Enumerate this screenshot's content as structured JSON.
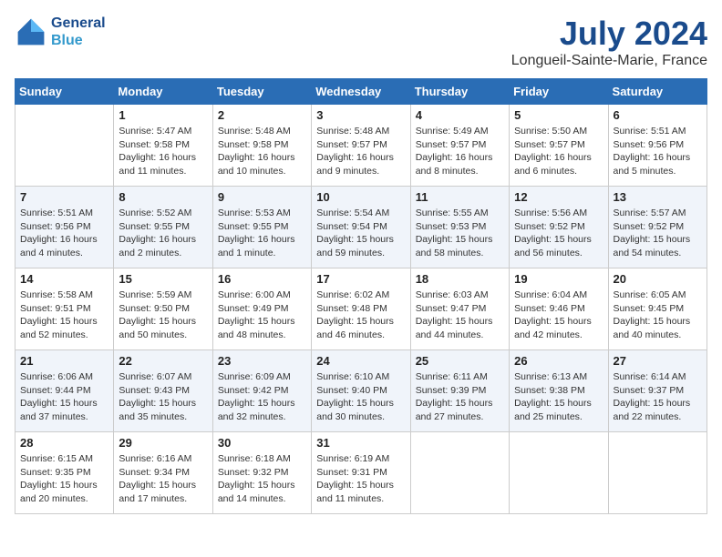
{
  "header": {
    "logo_line1": "General",
    "logo_line2": "Blue",
    "month": "July 2024",
    "location": "Longueil-Sainte-Marie, France"
  },
  "weekdays": [
    "Sunday",
    "Monday",
    "Tuesday",
    "Wednesday",
    "Thursday",
    "Friday",
    "Saturday"
  ],
  "weeks": [
    [
      {
        "day": "",
        "info": ""
      },
      {
        "day": "1",
        "info": "Sunrise: 5:47 AM\nSunset: 9:58 PM\nDaylight: 16 hours\nand 11 minutes."
      },
      {
        "day": "2",
        "info": "Sunrise: 5:48 AM\nSunset: 9:58 PM\nDaylight: 16 hours\nand 10 minutes."
      },
      {
        "day": "3",
        "info": "Sunrise: 5:48 AM\nSunset: 9:57 PM\nDaylight: 16 hours\nand 9 minutes."
      },
      {
        "day": "4",
        "info": "Sunrise: 5:49 AM\nSunset: 9:57 PM\nDaylight: 16 hours\nand 8 minutes."
      },
      {
        "day": "5",
        "info": "Sunrise: 5:50 AM\nSunset: 9:57 PM\nDaylight: 16 hours\nand 6 minutes."
      },
      {
        "day": "6",
        "info": "Sunrise: 5:51 AM\nSunset: 9:56 PM\nDaylight: 16 hours\nand 5 minutes."
      }
    ],
    [
      {
        "day": "7",
        "info": "Sunrise: 5:51 AM\nSunset: 9:56 PM\nDaylight: 16 hours\nand 4 minutes."
      },
      {
        "day": "8",
        "info": "Sunrise: 5:52 AM\nSunset: 9:55 PM\nDaylight: 16 hours\nand 2 minutes."
      },
      {
        "day": "9",
        "info": "Sunrise: 5:53 AM\nSunset: 9:55 PM\nDaylight: 16 hours\nand 1 minute."
      },
      {
        "day": "10",
        "info": "Sunrise: 5:54 AM\nSunset: 9:54 PM\nDaylight: 15 hours\nand 59 minutes."
      },
      {
        "day": "11",
        "info": "Sunrise: 5:55 AM\nSunset: 9:53 PM\nDaylight: 15 hours\nand 58 minutes."
      },
      {
        "day": "12",
        "info": "Sunrise: 5:56 AM\nSunset: 9:52 PM\nDaylight: 15 hours\nand 56 minutes."
      },
      {
        "day": "13",
        "info": "Sunrise: 5:57 AM\nSunset: 9:52 PM\nDaylight: 15 hours\nand 54 minutes."
      }
    ],
    [
      {
        "day": "14",
        "info": "Sunrise: 5:58 AM\nSunset: 9:51 PM\nDaylight: 15 hours\nand 52 minutes."
      },
      {
        "day": "15",
        "info": "Sunrise: 5:59 AM\nSunset: 9:50 PM\nDaylight: 15 hours\nand 50 minutes."
      },
      {
        "day": "16",
        "info": "Sunrise: 6:00 AM\nSunset: 9:49 PM\nDaylight: 15 hours\nand 48 minutes."
      },
      {
        "day": "17",
        "info": "Sunrise: 6:02 AM\nSunset: 9:48 PM\nDaylight: 15 hours\nand 46 minutes."
      },
      {
        "day": "18",
        "info": "Sunrise: 6:03 AM\nSunset: 9:47 PM\nDaylight: 15 hours\nand 44 minutes."
      },
      {
        "day": "19",
        "info": "Sunrise: 6:04 AM\nSunset: 9:46 PM\nDaylight: 15 hours\nand 42 minutes."
      },
      {
        "day": "20",
        "info": "Sunrise: 6:05 AM\nSunset: 9:45 PM\nDaylight: 15 hours\nand 40 minutes."
      }
    ],
    [
      {
        "day": "21",
        "info": "Sunrise: 6:06 AM\nSunset: 9:44 PM\nDaylight: 15 hours\nand 37 minutes."
      },
      {
        "day": "22",
        "info": "Sunrise: 6:07 AM\nSunset: 9:43 PM\nDaylight: 15 hours\nand 35 minutes."
      },
      {
        "day": "23",
        "info": "Sunrise: 6:09 AM\nSunset: 9:42 PM\nDaylight: 15 hours\nand 32 minutes."
      },
      {
        "day": "24",
        "info": "Sunrise: 6:10 AM\nSunset: 9:40 PM\nDaylight: 15 hours\nand 30 minutes."
      },
      {
        "day": "25",
        "info": "Sunrise: 6:11 AM\nSunset: 9:39 PM\nDaylight: 15 hours\nand 27 minutes."
      },
      {
        "day": "26",
        "info": "Sunrise: 6:13 AM\nSunset: 9:38 PM\nDaylight: 15 hours\nand 25 minutes."
      },
      {
        "day": "27",
        "info": "Sunrise: 6:14 AM\nSunset: 9:37 PM\nDaylight: 15 hours\nand 22 minutes."
      }
    ],
    [
      {
        "day": "28",
        "info": "Sunrise: 6:15 AM\nSunset: 9:35 PM\nDaylight: 15 hours\nand 20 minutes."
      },
      {
        "day": "29",
        "info": "Sunrise: 6:16 AM\nSunset: 9:34 PM\nDaylight: 15 hours\nand 17 minutes."
      },
      {
        "day": "30",
        "info": "Sunrise: 6:18 AM\nSunset: 9:32 PM\nDaylight: 15 hours\nand 14 minutes."
      },
      {
        "day": "31",
        "info": "Sunrise: 6:19 AM\nSunset: 9:31 PM\nDaylight: 15 hours\nand 11 minutes."
      },
      {
        "day": "",
        "info": ""
      },
      {
        "day": "",
        "info": ""
      },
      {
        "day": "",
        "info": ""
      }
    ]
  ]
}
